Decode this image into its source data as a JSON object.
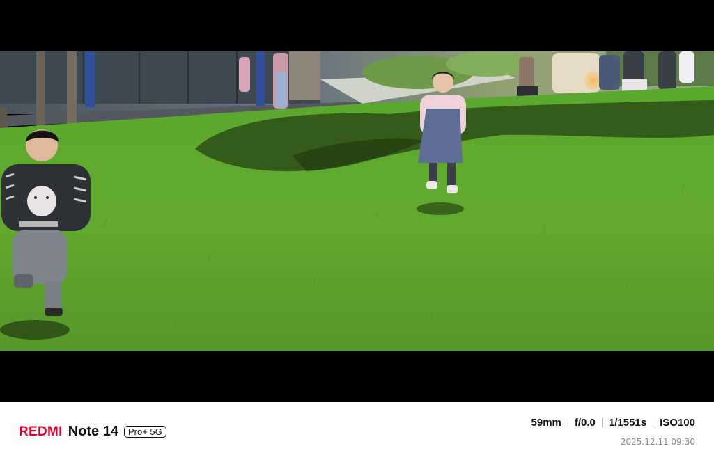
{
  "photo": {
    "subject": "children-running-on-lawn",
    "colors": {
      "letterbox": "#000000",
      "grass": "#5fa630",
      "shade": "#2b4a14"
    }
  },
  "watermark": {
    "brand": "REDMI",
    "model": "Note 14",
    "variant": "Pro+ 5G",
    "exif": {
      "focal_length": "59mm",
      "aperture": "f/0.0",
      "shutter": "1/1551s",
      "iso": "ISO100"
    },
    "datetime": "2025.12.11 09:30",
    "colors": {
      "brand": "#e4002b",
      "text": "#111111",
      "muted": "#888888"
    }
  }
}
